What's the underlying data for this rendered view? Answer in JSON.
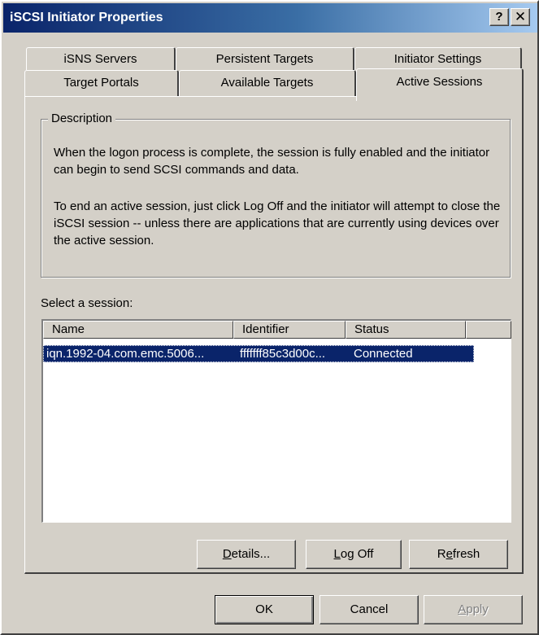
{
  "window": {
    "title": "iSCSI Initiator Properties",
    "help_glyph": "?",
    "close_glyph": "✕"
  },
  "tabs": {
    "row1": [
      "iSNS Servers",
      "Persistent Targets",
      "Initiator Settings"
    ],
    "row2": [
      "Target Portals",
      "Available Targets",
      "Active Sessions"
    ],
    "active": "Active Sessions"
  },
  "description": {
    "legend": "Description",
    "paragraph1": "When the logon process is complete, the session is fully enabled and the initiator can begin to send SCSI commands and data.",
    "paragraph2": "To end an active session, just click Log Off and the initiator will attempt to close the iSCSI session -- unless there are applications that are currently using devices over the active session."
  },
  "sessions": {
    "label": "Select a session:",
    "columns": [
      "Name",
      "Identifier",
      "Status"
    ],
    "rows": [
      {
        "name": "iqn.1992-04.com.emc.5006...",
        "identifier": "fffffff85c3d00c...",
        "status": "Connected",
        "selected": true
      }
    ]
  },
  "panel_buttons": {
    "details": {
      "pre": "",
      "accel": "D",
      "post": "etails..."
    },
    "logoff": {
      "pre": "",
      "accel": "L",
      "post": "og Off"
    },
    "refresh": {
      "pre": "R",
      "accel": "e",
      "post": "fresh"
    }
  },
  "dialog_buttons": {
    "ok": "OK",
    "cancel": "Cancel",
    "apply": {
      "pre": "",
      "accel": "A",
      "post": "pply",
      "enabled": false
    }
  },
  "colors": {
    "face": "#d4d0c8",
    "titlebar_start": "#0a246a",
    "titlebar_end": "#a6caf0",
    "selection": "#0a246a"
  }
}
